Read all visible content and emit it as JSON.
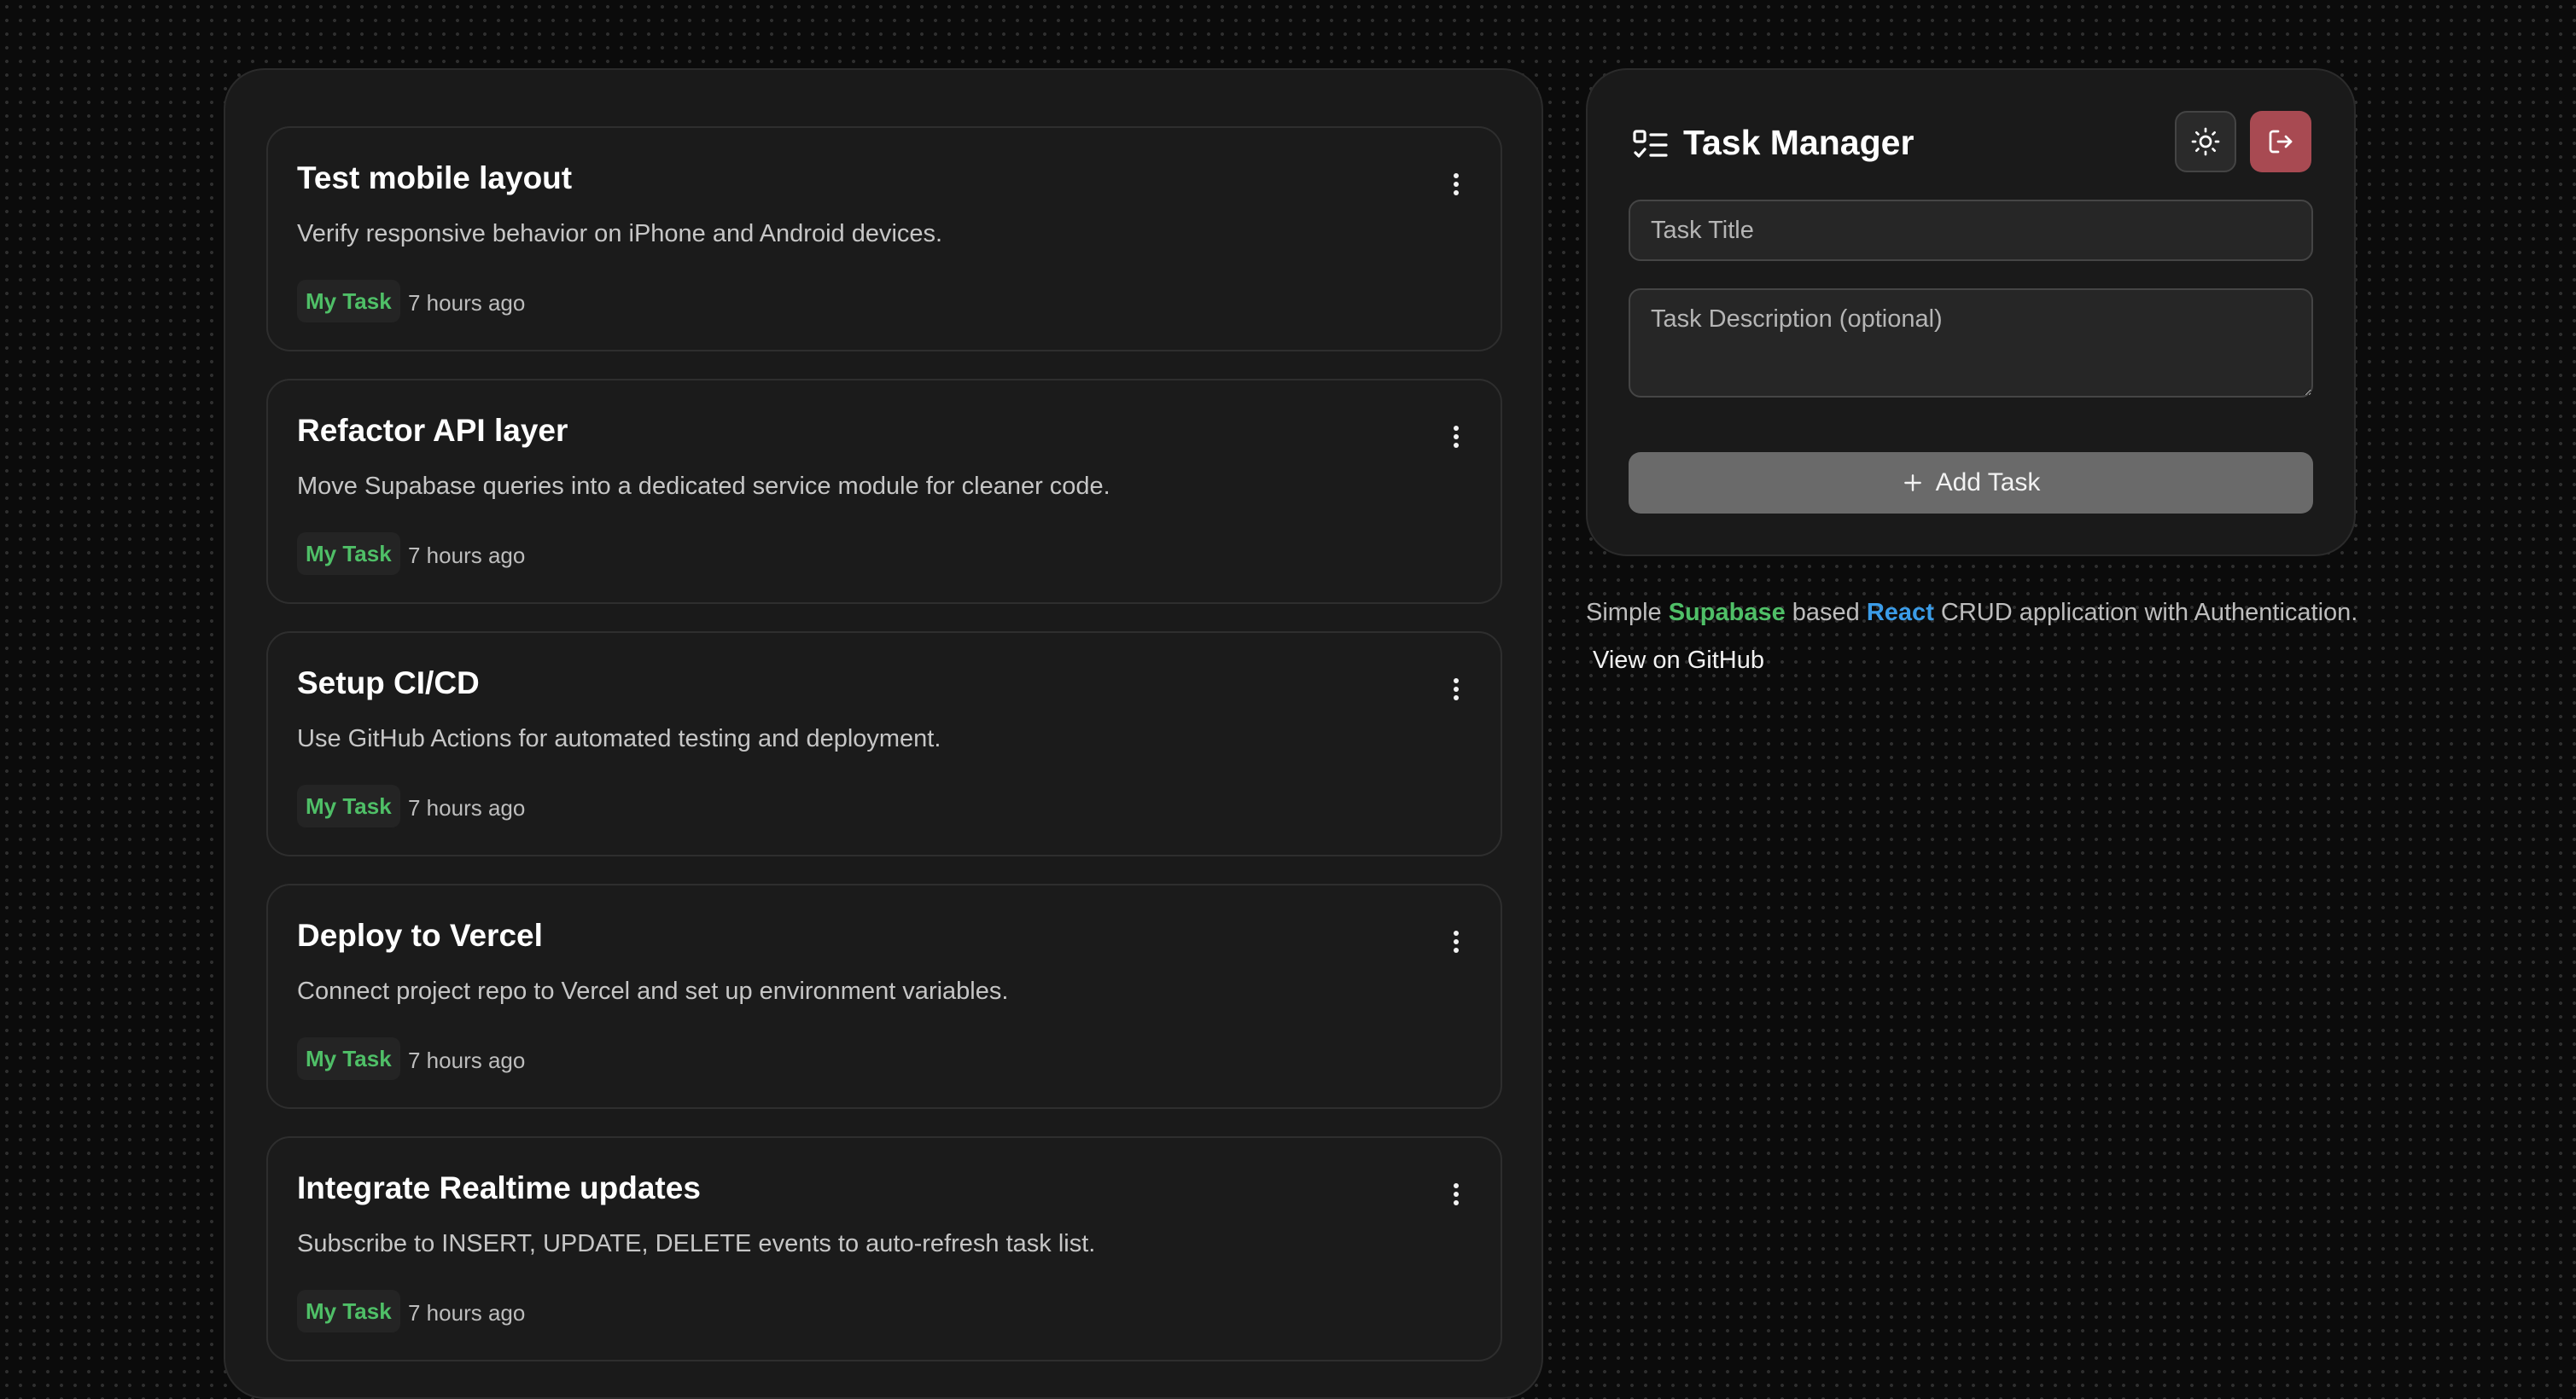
{
  "tasks": [
    {
      "title": "Test mobile layout",
      "description": "Verify responsive behavior on iPhone and Android devices.",
      "badge": "My Task",
      "time": "7 hours ago"
    },
    {
      "title": "Refactor API layer",
      "description": "Move Supabase queries into a dedicated service module for cleaner code.",
      "badge": "My Task",
      "time": "7 hours ago"
    },
    {
      "title": "Setup CI/CD",
      "description": "Use GitHub Actions for automated testing and deployment.",
      "badge": "My Task",
      "time": "7 hours ago"
    },
    {
      "title": "Deploy to Vercel",
      "description": "Connect project repo to Vercel and set up environment variables.",
      "badge": "My Task",
      "time": "7 hours ago"
    },
    {
      "title": "Integrate Realtime updates",
      "description": "Subscribe to INSERT, UPDATE, DELETE events to auto-refresh task list.",
      "badge": "My Task",
      "time": "7 hours ago"
    }
  ],
  "header": {
    "title": "Task Manager",
    "icon": "checklist-icon",
    "theme_icon": "sun-icon",
    "logout_icon": "logout-icon"
  },
  "form": {
    "title_placeholder": "Task Title",
    "title_value": "",
    "description_placeholder": "Task Description (optional)",
    "description_value": "",
    "add_label": "Add Task",
    "add_icon": "plus-icon"
  },
  "footer": {
    "prefix": "Simple",
    "supabase": "Supabase",
    "middle": "based",
    "react": "React",
    "suffix": "CRUD application with Authentication.",
    "github_link": "View on GitHub"
  },
  "colors": {
    "background": "#0b0b0b",
    "panel": "#1a1a1a",
    "badge_text": "#4fbf67",
    "supabase": "#4fbf67",
    "react": "#3b9ce8",
    "logout": "#a84a52",
    "add_button": "#6a6a6a"
  }
}
